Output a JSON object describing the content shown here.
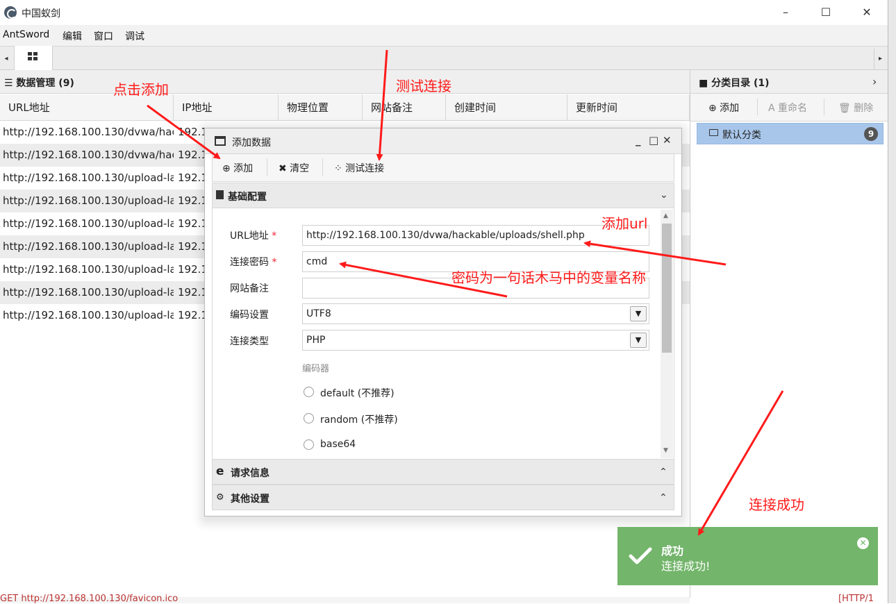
{
  "window": {
    "title": "中国蚁剑",
    "minimize": "–",
    "maximize": "☐",
    "close": "✕"
  },
  "menu": [
    "AntSword",
    "编辑",
    "窗口",
    "调试"
  ],
  "tabs": {
    "scroll_left": "◂",
    "scroll_right": "▸"
  },
  "data_panel": {
    "title": "☰ 数据管理 (9)",
    "columns": [
      "URL地址",
      "IP地址",
      "物理位置",
      "网站备注",
      "创建时间",
      "更新时间"
    ],
    "rows": [
      {
        "url": "http://192.168.100.130/dvwa/hac",
        "ip": "192.1"
      },
      {
        "url": "http://192.168.100.130/dvwa/hac",
        "ip": "192.1"
      },
      {
        "url": "http://192.168.100.130/upload-lal",
        "ip": "192.1"
      },
      {
        "url": "http://192.168.100.130/upload-lal",
        "ip": "192.1"
      },
      {
        "url": "http://192.168.100.130/upload-lal",
        "ip": "192.1"
      },
      {
        "url": "http://192.168.100.130/upload-lal",
        "ip": "192.1"
      },
      {
        "url": "http://192.168.100.130/upload-lal",
        "ip": "192.1"
      },
      {
        "url": "http://192.168.100.130/upload-lal",
        "ip": "192.1"
      },
      {
        "url": "http://192.168.100.130/upload-lal",
        "ip": "192.1"
      }
    ]
  },
  "category_panel": {
    "title": "■ 分类目录 (1)",
    "chevron": "›",
    "toolbar": {
      "add": "⊕ 添加",
      "rename": "A 重命名",
      "delete": "🗑 删除"
    },
    "item_label": "默认分类",
    "item_count": "9"
  },
  "dialog": {
    "title": "添加数据",
    "controls": {
      "minimize": "_",
      "maximize": "□",
      "close": "✕"
    },
    "toolbar": {
      "add": "⊕ 添加",
      "clear": "✖ 清空",
      "test": "⁘ 测试连接"
    },
    "sections": {
      "basic": "基础配置",
      "request": "请求信息",
      "other": "其他设置"
    },
    "form": {
      "url_label": "URL地址",
      "url_value": "http://192.168.100.130/dvwa/hackable/uploads/shell.php",
      "password_label": "连接密码",
      "password_value": "cmd",
      "note_label": "网站备注",
      "note_value": "",
      "encoding_label": "编码设置",
      "encoding_value": "UTF8",
      "type_label": "连接类型",
      "type_value": "PHP",
      "encoder_label": "编码器",
      "encoders": [
        "default (不推荐)",
        "random (不推荐)",
        "base64"
      ],
      "required_mark": "*"
    }
  },
  "toast": {
    "title": "成功",
    "message": "连接成功!",
    "color": "#73b56b"
  },
  "annotations": {
    "click_add": "点击添加",
    "test_connection": "测试连接",
    "add_url": "添加url",
    "password_note": "密码为一句话木马中的变量名称",
    "connect_success": "连接成功",
    "color": "#ff1a1a"
  },
  "bottom_log": {
    "left": "GET http://192.168.100.130/favicon.ico",
    "right": "[HTTP/1"
  }
}
